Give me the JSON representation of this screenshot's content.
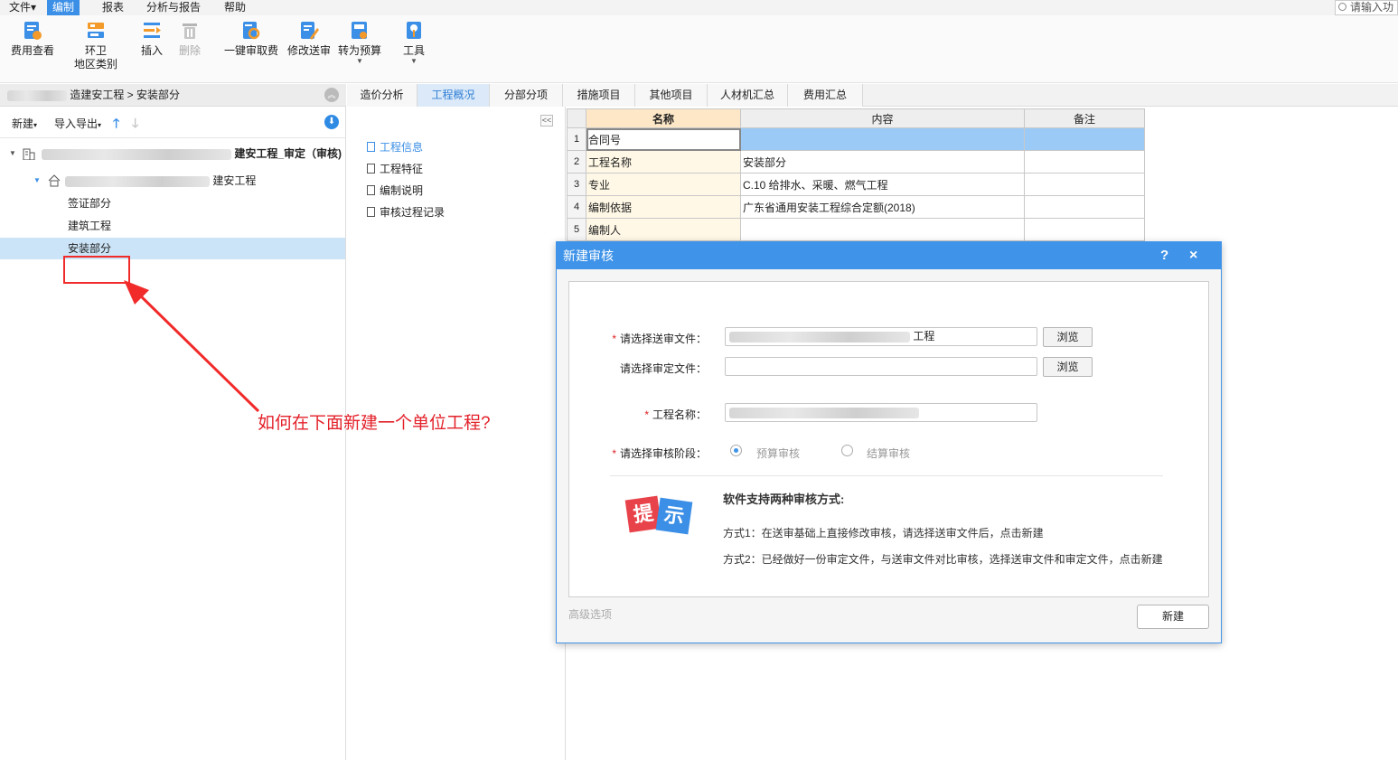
{
  "menubar": {
    "items": [
      "文件",
      "编制",
      "报表",
      "分析与报告",
      "帮助"
    ],
    "active": "编制",
    "search_placeholder": "请输入功"
  },
  "toolbar": {
    "fee_view": "费用查看",
    "env_line1": "环卫",
    "env_line2": "地区类别",
    "insert": "插入",
    "delete": "删除",
    "one_click": "一键审取费",
    "modify_send": "修改送审",
    "to_budget": "转为预算",
    "tools": "工具"
  },
  "left": {
    "breadcrumb_tail": "造建安工程 > 安装部分",
    "new_label": "新建",
    "import_export": "导入导出",
    "tree": {
      "root_suffix": "建安工程_审定（审核)",
      "child_suffix": "建安工程",
      "items": [
        "签证部分",
        "建筑工程",
        "安装部分"
      ]
    }
  },
  "tabs": [
    "造价分析",
    "工程概况",
    "分部分项",
    "措施项目",
    "其他项目",
    "人材机汇总",
    "费用汇总"
  ],
  "active_tab": "工程概况",
  "mid": {
    "items": [
      "工程信息",
      "工程特征",
      "编制说明",
      "审核过程记录"
    ],
    "active": "工程信息"
  },
  "grid": {
    "headers": [
      "名称",
      "内容",
      "备注"
    ],
    "rows": [
      {
        "num": "1",
        "name": "合同号",
        "content": "",
        "note": ""
      },
      {
        "num": "2",
        "name": "工程名称",
        "content": "安装部分",
        "note": ""
      },
      {
        "num": "3",
        "name": "专业",
        "content": "C.10 给排水、采暖、燃气工程",
        "note": ""
      },
      {
        "num": "4",
        "name": "编制依据",
        "content": "广东省通用安装工程综合定额(2018)",
        "note": ""
      },
      {
        "num": "5",
        "name": "编制人",
        "content": "",
        "note": ""
      }
    ]
  },
  "dialog": {
    "title": "新建审核",
    "help": "?",
    "close": "×",
    "send_file_label": "请选择送审文件：",
    "send_file_suffix": "工程",
    "approved_file_label": "请选择审定文件：",
    "browse": "浏览",
    "project_name_label": "工程名称：",
    "stage_label": "请选择审核阶段：",
    "stage_budget": "预算审核",
    "stage_settlement": "结算审核",
    "tip_badge_1": "提",
    "tip_badge_2": "示",
    "tip_title": "软件支持两种审核方式:",
    "tip_way1": "方式1：在送审基础上直接修改审核，请选择送审文件后，点击新建",
    "tip_way2": "方式2：已经做好一份审定文件，与送审文件对比审核，选择送审文件和审定文件，点击新建",
    "advanced": "高级选项",
    "create": "新建"
  },
  "annotation": {
    "text": "如何在下面新建一个单位工程?"
  }
}
